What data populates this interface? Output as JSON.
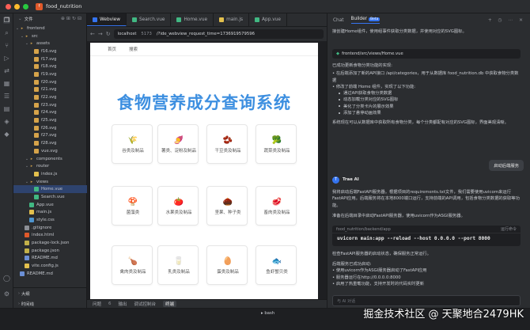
{
  "window": {
    "project_name": "food_nutrition"
  },
  "explorer": {
    "title": "文件",
    "tree": [
      {
        "label": "frontend",
        "type": "folder",
        "indent": 0
      },
      {
        "label": "src",
        "type": "folder",
        "indent": 1
      },
      {
        "label": "assets",
        "type": "folder",
        "indent": 2
      },
      {
        "label": "f16.svg",
        "type": "svg",
        "indent": 3
      },
      {
        "label": "f17.svg",
        "type": "svg",
        "indent": 3
      },
      {
        "label": "f18.svg",
        "type": "svg",
        "indent": 3
      },
      {
        "label": "f19.svg",
        "type": "svg",
        "indent": 3
      },
      {
        "label": "f20.svg",
        "type": "svg",
        "indent": 3
      },
      {
        "label": "f21.svg",
        "type": "svg",
        "indent": 3
      },
      {
        "label": "f22.svg",
        "type": "svg",
        "indent": 3
      },
      {
        "label": "f23.svg",
        "type": "svg",
        "indent": 3
      },
      {
        "label": "f24.svg",
        "type": "svg",
        "indent": 3
      },
      {
        "label": "f25.svg",
        "type": "svg",
        "indent": 3
      },
      {
        "label": "f26.svg",
        "type": "svg",
        "indent": 3
      },
      {
        "label": "f27.svg",
        "type": "svg",
        "indent": 3
      },
      {
        "label": "f28.svg",
        "type": "svg",
        "indent": 3
      },
      {
        "label": "vue.svg",
        "type": "svg",
        "indent": 3
      },
      {
        "label": "components",
        "type": "folder",
        "indent": 2
      },
      {
        "label": "router",
        "type": "folder",
        "indent": 2
      },
      {
        "label": "index.js",
        "type": "js",
        "indent": 3
      },
      {
        "label": "views",
        "type": "folder",
        "indent": 2
      },
      {
        "label": "Home.vue",
        "type": "vue",
        "indent": 3,
        "selected": true
      },
      {
        "label": "Search.vue",
        "type": "vue",
        "indent": 3
      },
      {
        "label": "App.vue",
        "type": "vue",
        "indent": 2
      },
      {
        "label": "main.js",
        "type": "js",
        "indent": 2
      },
      {
        "label": "style.css",
        "type": "css",
        "indent": 2
      },
      {
        "label": ".gitignore",
        "type": "git",
        "indent": 1
      },
      {
        "label": "index.html",
        "type": "html",
        "indent": 1
      },
      {
        "label": "package-lock.json",
        "type": "json",
        "indent": 1
      },
      {
        "label": "package.json",
        "type": "json",
        "indent": 1
      },
      {
        "label": "README.md",
        "type": "md",
        "indent": 1
      },
      {
        "label": "vite.config.js",
        "type": "js",
        "indent": 1
      },
      {
        "label": "README.md",
        "type": "md",
        "indent": 0
      }
    ],
    "footer": [
      "大纲",
      "时间线"
    ]
  },
  "editor": {
    "tabs": [
      {
        "label": "Webview",
        "active": true,
        "color": "#3574f0"
      },
      {
        "label": "Search.vue",
        "active": false,
        "color": "#41b883"
      },
      {
        "label": "Home.vue",
        "active": false,
        "color": "#41b883"
      },
      {
        "label": "main.js",
        "active": false,
        "color": "#e3c04d"
      },
      {
        "label": "App.vue",
        "active": false,
        "color": "#41b883"
      }
    ],
    "url": {
      "host": "localhost",
      "port": "5173",
      "path": "/?ide_webview_request_time=1736919579596"
    }
  },
  "webpage": {
    "nav": [
      "首页",
      "搜索"
    ],
    "title": "食物营养成分查询系统",
    "categories": [
      {
        "label": "谷类及制品",
        "icon": "🌾"
      },
      {
        "label": "薯类、淀粉及制品",
        "icon": "🍠"
      },
      {
        "label": "干豆类及制品",
        "icon": "🫘"
      },
      {
        "label": "蔬菜类及制品",
        "icon": "🥦"
      },
      {
        "label": "菌藻类",
        "icon": "🍄"
      },
      {
        "label": "水果类及制品",
        "icon": "🍅"
      },
      {
        "label": "坚果、种子类",
        "icon": "🌰"
      },
      {
        "label": "畜肉类及制品",
        "icon": "🥩"
      },
      {
        "label": "禽肉类及制品",
        "icon": "🍗"
      },
      {
        "label": "乳类及制品",
        "icon": "🥛"
      },
      {
        "label": "蛋类及制品",
        "icon": "🥚"
      },
      {
        "label": "鱼虾蟹贝类",
        "icon": "🐟"
      }
    ]
  },
  "chat": {
    "tabs": {
      "chat": "Chat",
      "builder": "Builder",
      "beta": "Beta"
    },
    "intro": "接创建Home组件，使用组事件获取分类数据，并使用对应的SVG图标。",
    "file": "frontend/src/views/Home.vue",
    "updated": "已成功更新食物分类功能的实现:",
    "list1": [
      "在后端添加了新的API接口 /api/categories，用于从数据库 food_nutrition.db 中获取食物分类数据",
      "修改了前端 Home 组件，实现了以下功能:"
    ],
    "sublist": [
      "通过API获取食物分类数据",
      "动态加载分类对应的SVG图标",
      "美化了分类卡片的展示效果",
      "添加了悬停动画效果"
    ],
    "summary": "系统现在可以从数据库中获取所有食物分类，每个分类都配有对应的SVG图标，界面美观清晰。",
    "user_msg": "启动后端服务",
    "assistant_name": "Trae AI",
    "reply1": "我将启动后端FastAPI服务器。根据项目的requirements.txt文件，我们需要使用uvicorn来运行FastAPI应用。后端服务将在本地8000端口运行，支持前端的API调用，包括食物分类数据的获取等功能。",
    "reply2": "准备在后端目录中启动FastAPI服务器，使用uvicorn作为ASGI服务器。",
    "cmd_path": "food_nutrition/backend/app",
    "cmd_run": "运行命令",
    "command": "uvicorn main:app --reload --host 0.0.0.0 --port 8000",
    "reply3": "检查FastAPI服务器的启动状态，确保服务正常运行。",
    "reply4": "后端服务已成功启动:",
    "list2": [
      "使用uvicorn作为ASGI服务器启动了FastAPI应用",
      "服务器运行在http://0.0.0.0:8000",
      "启用了热重载功能，支持开发时的代码实时更新"
    ],
    "input_placeholder": "与 AI 对话"
  },
  "bottom": {
    "tabs": [
      "问题",
      "输出",
      "调试控制台",
      "终端"
    ],
    "active_tab": "终端",
    "term_label": "bash",
    "count": "6"
  },
  "watermark": "掘金技术社区 @ 天聚地合2479HK"
}
